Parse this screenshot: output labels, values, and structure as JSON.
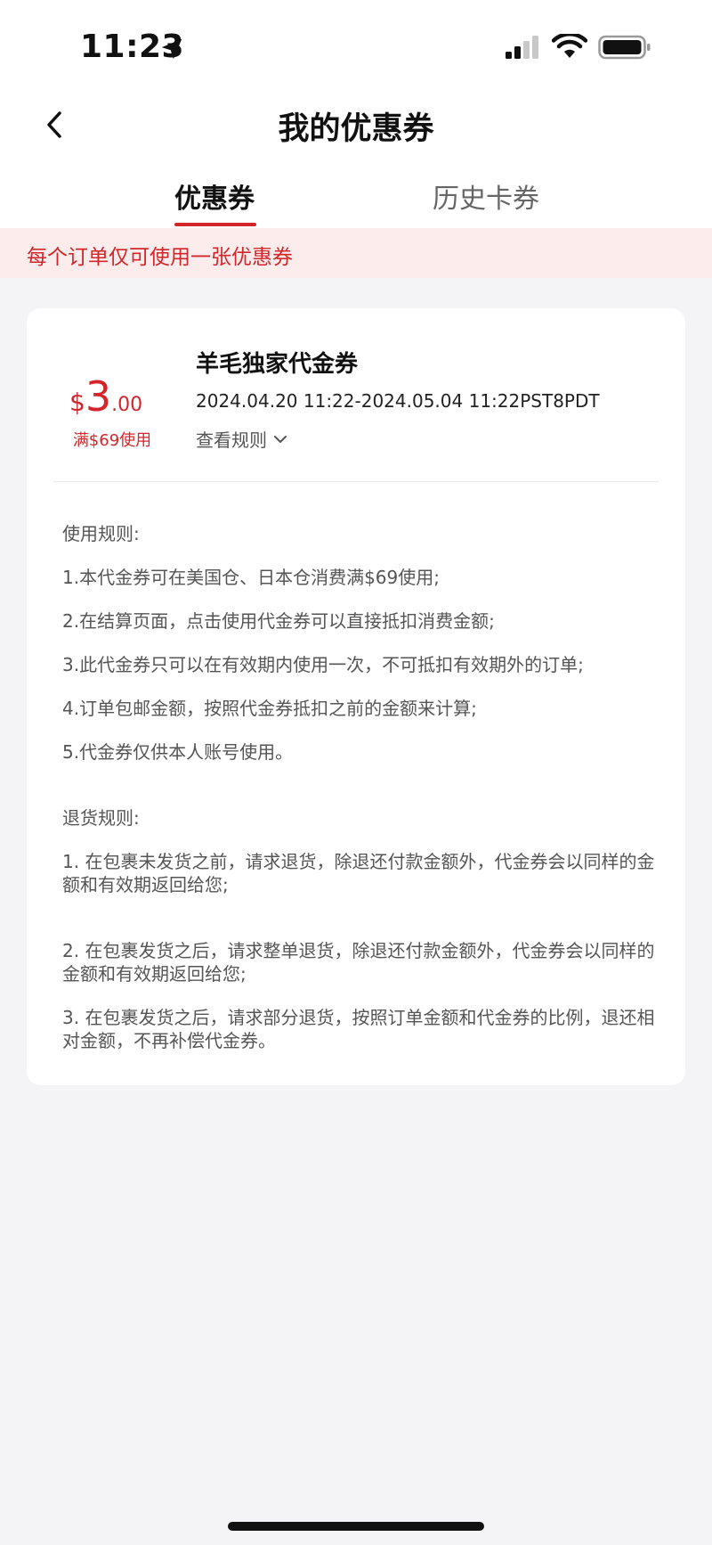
{
  "status_bar": {
    "time": "11:23",
    "icons": [
      "location-arrow-icon",
      "signal-icon",
      "wifi-icon",
      "battery-icon"
    ]
  },
  "header": {
    "title": "我的优惠券",
    "back_icon": "chevron-left-icon"
  },
  "tabs": [
    {
      "label": "优惠券",
      "active": true
    },
    {
      "label": "历史卡券",
      "active": false
    }
  ],
  "notice": {
    "text": "每个订单仅可使用一张优惠券"
  },
  "coupon": {
    "currency": "$",
    "amount_int": "3",
    "amount_dec": ".00",
    "threshold": "满$69使用",
    "name": "羊毛独家代金券",
    "validity": "2024.04.20 11:22-2024.05.04 11:22PST8PDT",
    "view_rules_label": "查看规则",
    "usage_rules": {
      "heading": "使用规则:",
      "items": [
        "1.本代金券可在美国仓、日本仓消费满$69使用;",
        "2.在结算页面，点击使用代金券可以直接抵扣消费金额;",
        "3.此代金券只可以在有效期内使用一次，不可抵扣有效期外的订单;",
        "4.订单包邮金额，按照代金券抵扣之前的金额来计算;",
        "5.代金券仅供本人账号使用。"
      ]
    },
    "return_rules": {
      "heading": "退货规则:",
      "items": [
        "1. 在包裹未发货之前，请求退货，除退还付款金额外，代金券会以同样的金额和有效期返回给您;",
        "2. 在包裹发货之后，请求整单退货，除退还付款金额外，代金券会以同样的金额和有效期返回给您;",
        "3. 在包裹发货之后，请求部分退货，按照订单金额和代金券的比例，退还相对金额，不再补偿代金券。"
      ]
    }
  },
  "colors": {
    "accent": "#d3262b",
    "notice_bg": "#fdecec",
    "page_bg": "#f4f4f6"
  }
}
